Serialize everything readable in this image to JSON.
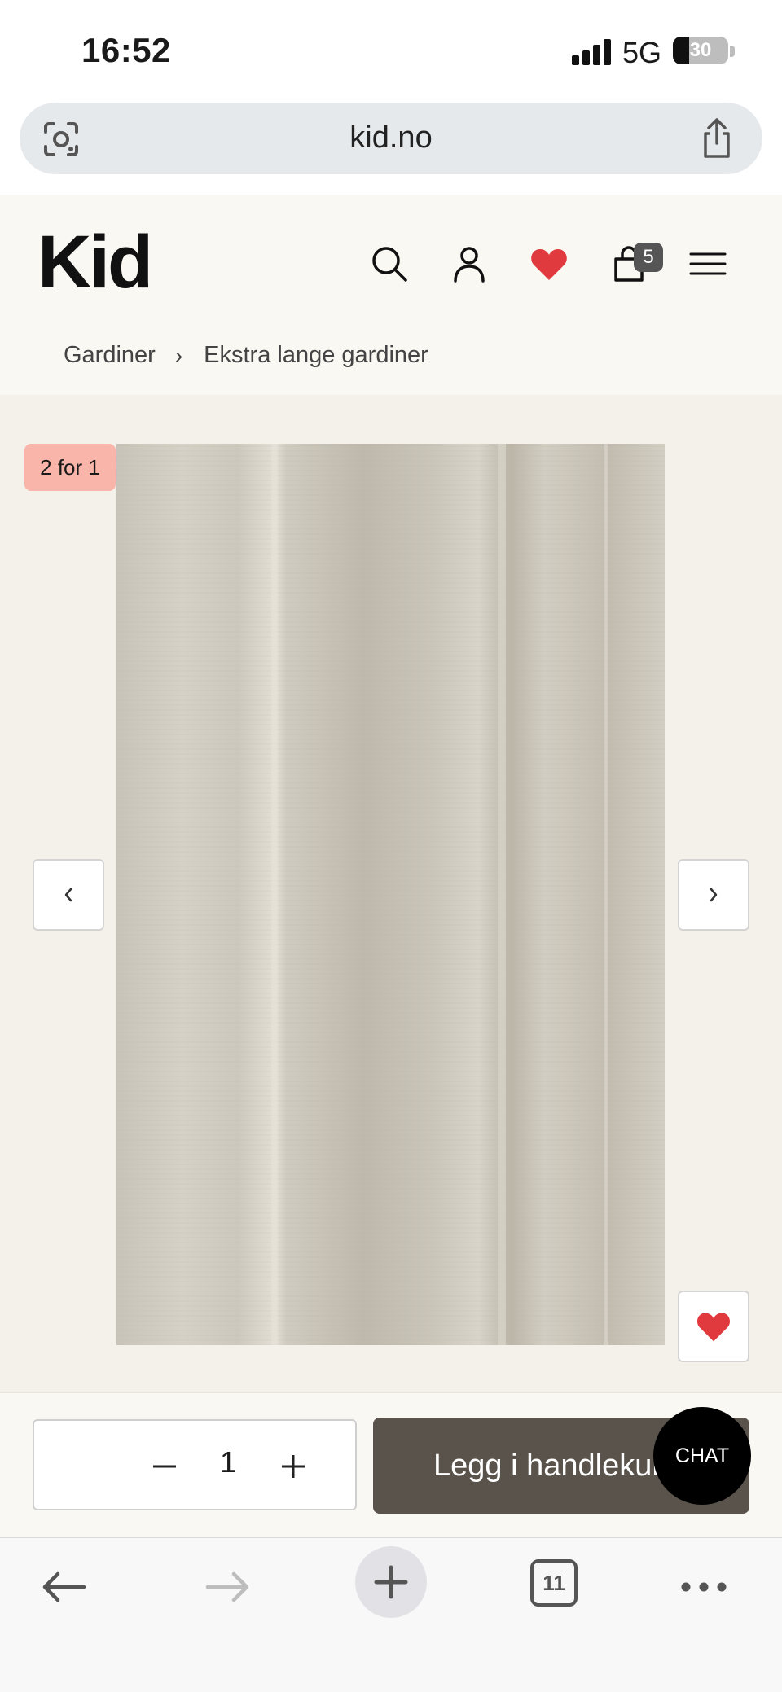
{
  "status_bar": {
    "time": "16:52",
    "network": "5G",
    "battery_percent": "30",
    "battery_level": 0.3
  },
  "browser": {
    "url": "kid.no",
    "tabs_count": "11"
  },
  "site": {
    "logo": "Kid",
    "cart_count": "5",
    "breadcrumb": [
      "Gardiner",
      "Ekstra lange gardiner"
    ]
  },
  "product": {
    "promo_badge": "2 for 1",
    "quantity": "1",
    "add_to_cart_label": "Legg i handlekurv",
    "chat_label": "CHAT"
  },
  "colors": {
    "accent_heart": "#e0393e",
    "promo_badge_bg": "#f9b5aa",
    "add_button_bg": "#5a534c",
    "header_bg": "#faf8f3",
    "gallery_bg": "#f4f1eb"
  },
  "icons": {
    "header": [
      "search-icon",
      "user-icon",
      "heart-icon",
      "bag-icon",
      "menu-icon"
    ],
    "gallery": [
      "chevron-left-icon",
      "chevron-right-icon",
      "heart-icon"
    ],
    "browser_toolbar": [
      "back-arrow-icon",
      "forward-arrow-icon",
      "plus-icon",
      "tabs-icon",
      "more-icon"
    ]
  }
}
